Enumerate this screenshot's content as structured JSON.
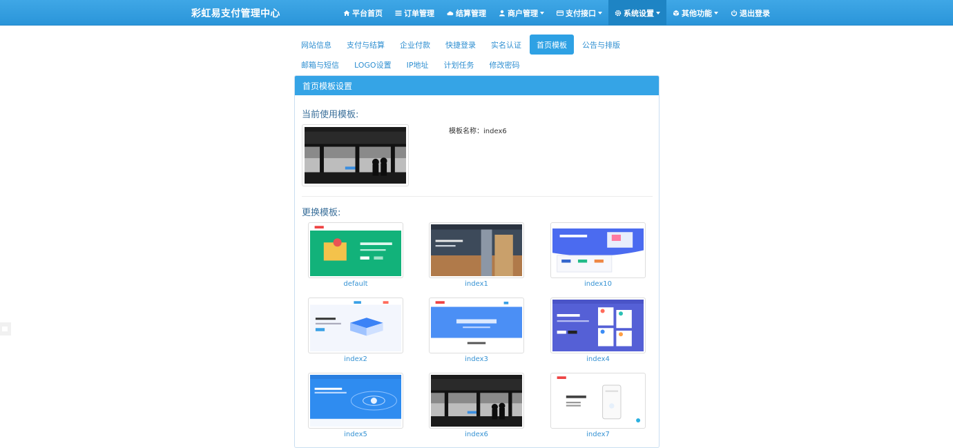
{
  "brand": "彩虹易支付管理中心",
  "nav": [
    {
      "label": "平台首页",
      "icon": "home-icon",
      "dropdown": false,
      "active": false
    },
    {
      "label": "订单管理",
      "icon": "list-icon",
      "dropdown": false,
      "active": false
    },
    {
      "label": "结算管理",
      "icon": "cloud-icon",
      "dropdown": false,
      "active": false
    },
    {
      "label": "商户管理",
      "icon": "user-icon",
      "dropdown": true,
      "active": false
    },
    {
      "label": "支付接口",
      "icon": "credit-card-icon",
      "dropdown": true,
      "active": false
    },
    {
      "label": "系统设置",
      "icon": "gear-icon",
      "dropdown": true,
      "active": true
    },
    {
      "label": "其他功能",
      "icon": "cube-icon",
      "dropdown": true,
      "active": false
    },
    {
      "label": "退出登录",
      "icon": "power-icon",
      "dropdown": false,
      "active": false
    }
  ],
  "tabs_row1": [
    {
      "label": "网站信息",
      "active": false
    },
    {
      "label": "支付与结算",
      "active": false
    },
    {
      "label": "企业付款",
      "active": false
    },
    {
      "label": "快捷登录",
      "active": false
    },
    {
      "label": "实名认证",
      "active": false
    },
    {
      "label": "首页模板",
      "active": true
    },
    {
      "label": "公告与排版",
      "active": false
    }
  ],
  "tabs_row2": [
    {
      "label": "邮箱与短信",
      "active": false
    },
    {
      "label": "LOGO设置",
      "active": false
    },
    {
      "label": "IP地址",
      "active": false
    },
    {
      "label": "计划任务",
      "active": false
    },
    {
      "label": "修改密码",
      "active": false
    }
  ],
  "panel": {
    "heading": "首页模板设置",
    "current_title": "当前使用模板:",
    "current_name": "模板名称：index6",
    "change_title": "更换模板:"
  },
  "templates": [
    {
      "name": "default",
      "style": "green"
    },
    {
      "name": "index1",
      "style": "city"
    },
    {
      "name": "index10",
      "style": "blue-illust"
    },
    {
      "name": "index2",
      "style": "isometric"
    },
    {
      "name": "index3",
      "style": "blue-banner"
    },
    {
      "name": "index4",
      "style": "indigo-cards"
    },
    {
      "name": "index5",
      "style": "blue-orbit"
    },
    {
      "name": "index6",
      "style": "bw-window"
    },
    {
      "name": "index7",
      "style": "white-phone"
    }
  ],
  "colors": {
    "navbar": "#2a95d9",
    "accent": "#2ea1e4",
    "link": "#3592d3"
  }
}
